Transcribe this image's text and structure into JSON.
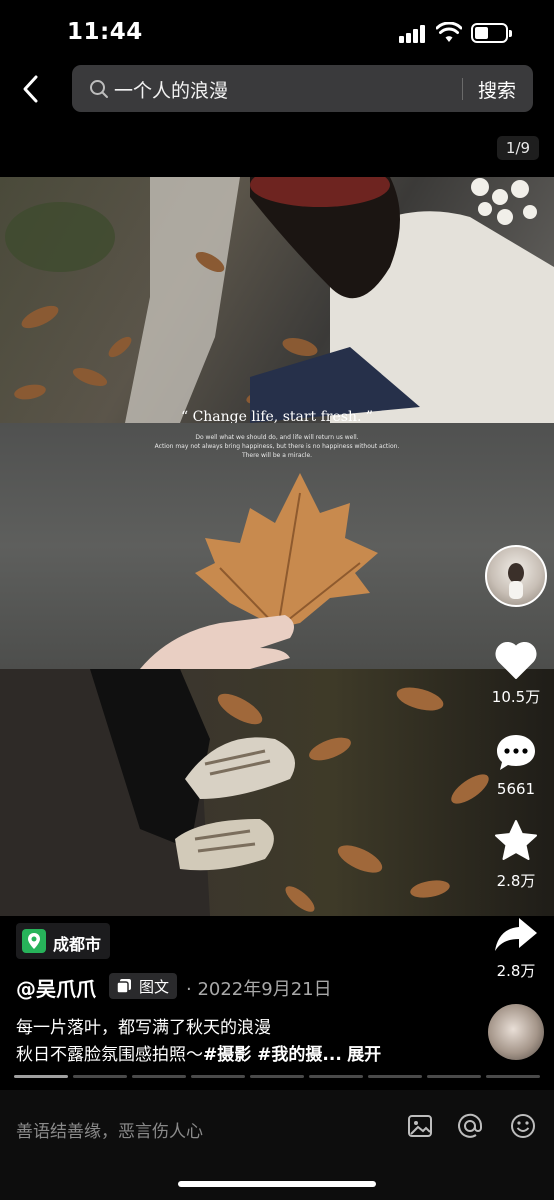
{
  "status_bar": {
    "time": "11:44"
  },
  "search": {
    "query": "一个人的浪漫",
    "button": "搜索"
  },
  "pager": "1/9",
  "photo": {
    "quote": "“ Change life, start fresh. ”",
    "subquote": [
      "Do well what we should do, and life will return us well.",
      "Action may not always bring happiness, but there is no happiness without action.",
      "There will be a miracle."
    ]
  },
  "actions": {
    "likes": "10.5万",
    "comments": "5661",
    "favorites": "2.8万",
    "shares": "2.8万"
  },
  "post": {
    "location": "成都市",
    "author": "@吴爪爪",
    "type_tag": "图文",
    "date": "· 2022年9月21日",
    "line1": "每一片落叶，都写满了秋天的浪漫",
    "line2_prefix": "秋日不露脸氛围感拍照～",
    "line2_tags": "#摄影 #我的摄...",
    "expand": "展开",
    "total_pages": 9,
    "current_page": 1
  },
  "comment_bar": {
    "placeholder": "善语结善缘，恶言伤人心"
  },
  "colors": {
    "location_pin": "#27b35a",
    "background": "#000000"
  }
}
